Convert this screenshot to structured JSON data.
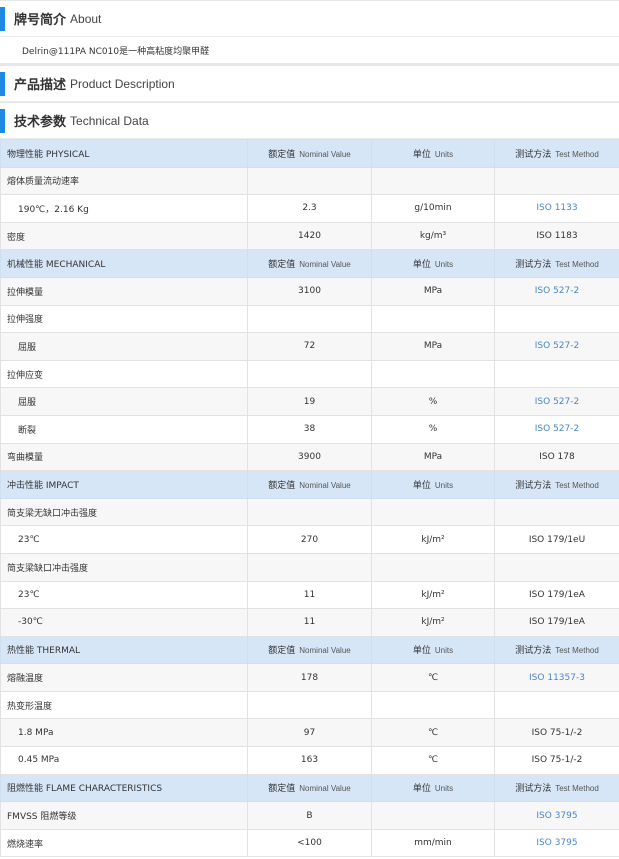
{
  "sections": {
    "about": {
      "title_cn": "牌号简介",
      "title_en": "About",
      "text": "Delrin@111PA NC010是一种高粘度均聚甲醛"
    },
    "description": {
      "title_cn": "产品描述",
      "title_en": "Product Description"
    },
    "technical": {
      "title_cn": "技术参数",
      "title_en": "Technical Data"
    }
  },
  "table_headers": {
    "nominal_cn": "额定值",
    "nominal_en": "Nominal Value",
    "units_cn": "单位",
    "units_en": "Units",
    "method_cn": "测试方法",
    "method_en": "Test Method"
  },
  "categories": [
    {
      "name": "物理性能 PHYSICAL",
      "rows": [
        {
          "name": "熔体质量流动速率",
          "value": "",
          "unit": "",
          "method": "",
          "sub": false,
          "link": false
        },
        {
          "name": "190℃，2.16 Kg",
          "value": "2.3",
          "unit": "g/10min",
          "method": "ISO 1133",
          "sub": true,
          "link": true
        },
        {
          "name": "密度",
          "value": "1420",
          "unit": "kg/m³",
          "method": "ISO 1183",
          "sub": false,
          "link": false
        }
      ]
    },
    {
      "name": "机械性能 MECHANICAL",
      "rows": [
        {
          "name": "拉伸模量",
          "value": "3100",
          "unit": "MPa",
          "method": "ISO 527-2",
          "sub": false,
          "link": true
        },
        {
          "name": "拉伸强度",
          "value": "",
          "unit": "",
          "method": "",
          "sub": false,
          "link": false
        },
        {
          "name": "屈服",
          "value": "72",
          "unit": "MPa",
          "method": "ISO 527-2",
          "sub": true,
          "link": true
        },
        {
          "name": "拉伸应变",
          "value": "",
          "unit": "",
          "method": "",
          "sub": false,
          "link": false
        },
        {
          "name": "屈服",
          "value": "19",
          "unit": "%",
          "method": "ISO 527-2",
          "sub": true,
          "link": true
        },
        {
          "name": "断裂",
          "value": "38",
          "unit": "%",
          "method": "ISO 527-2",
          "sub": true,
          "link": true
        },
        {
          "name": "弯曲模量",
          "value": "3900",
          "unit": "MPa",
          "method": "ISO 178",
          "sub": false,
          "link": false
        }
      ]
    },
    {
      "name": "冲击性能 IMPACT",
      "rows": [
        {
          "name": "简支梁无缺口冲击强度",
          "value": "",
          "unit": "",
          "method": "",
          "sub": false,
          "link": false
        },
        {
          "name": "23℃",
          "value": "270",
          "unit": "kJ/m²",
          "method": "ISO 179/1eU",
          "sub": true,
          "link": false
        },
        {
          "name": "简支梁缺口冲击强度",
          "value": "",
          "unit": "",
          "method": "",
          "sub": false,
          "link": false
        },
        {
          "name": "23℃",
          "value": "11",
          "unit": "kJ/m²",
          "method": "ISO 179/1eA",
          "sub": true,
          "link": false
        },
        {
          "name": "-30℃",
          "value": "11",
          "unit": "kJ/m²",
          "method": "ISO 179/1eA",
          "sub": true,
          "link": false
        }
      ]
    },
    {
      "name": "热性能 THERMAL",
      "rows": [
        {
          "name": "熔融温度",
          "value": "178",
          "unit": "℃",
          "method": "ISO 11357-3",
          "sub": false,
          "link": true
        },
        {
          "name": "热变形温度",
          "value": "",
          "unit": "",
          "method": "",
          "sub": false,
          "link": false
        },
        {
          "name": "1.8 MPa",
          "value": "97",
          "unit": "℃",
          "method": "ISO 75-1/-2",
          "sub": true,
          "link": false
        },
        {
          "name": "0.45 MPa",
          "value": "163",
          "unit": "℃",
          "method": "ISO 75-1/-2",
          "sub": true,
          "link": false
        }
      ]
    },
    {
      "name": "阻燃性能 FLAME CHARACTERISTICS",
      "rows": [
        {
          "name": "FMVSS 阻燃等级",
          "value": "B",
          "unit": "",
          "method": "ISO 3795",
          "sub": false,
          "link": true
        },
        {
          "name": "燃烧速率",
          "value": "<100",
          "unit": "mm/min",
          "method": "ISO 3795",
          "sub": false,
          "link": true
        }
      ]
    }
  ],
  "colors": {
    "accent": "#1e88e5",
    "header_bg": "#d6e6f7",
    "link": "#4a86c8"
  }
}
